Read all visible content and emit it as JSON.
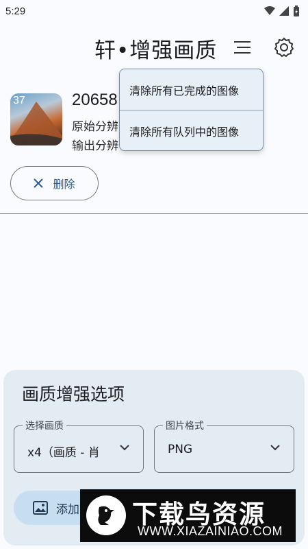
{
  "status_bar": {
    "time": "5:29"
  },
  "header": {
    "title": "轩•增强画质"
  },
  "dropdown_menu": {
    "items": [
      {
        "label": "清除所有已完成的图像"
      },
      {
        "label": "清除所有队列中的图像"
      }
    ]
  },
  "list": {
    "items": [
      {
        "thumb_badge": "37",
        "name": "20658",
        "original_res": "原始分辨",
        "output_res": "输出分辨",
        "delete_label": "删除"
      }
    ]
  },
  "options": {
    "title": "画质增强选项",
    "quality": {
      "label": "选择画质",
      "value": "x4（画质 - 肖"
    },
    "format": {
      "label": "图片格式",
      "value": "PNG"
    },
    "add_label": "添加"
  },
  "watermark": {
    "title": "下载鸟资源",
    "url": "WWW.XIAZAINIAO.COM"
  },
  "colors": {
    "card": "#e3ebf3",
    "menu": "#e8f0f7",
    "accent": "#2f5c8a",
    "add_button": "#c7ddf0"
  }
}
